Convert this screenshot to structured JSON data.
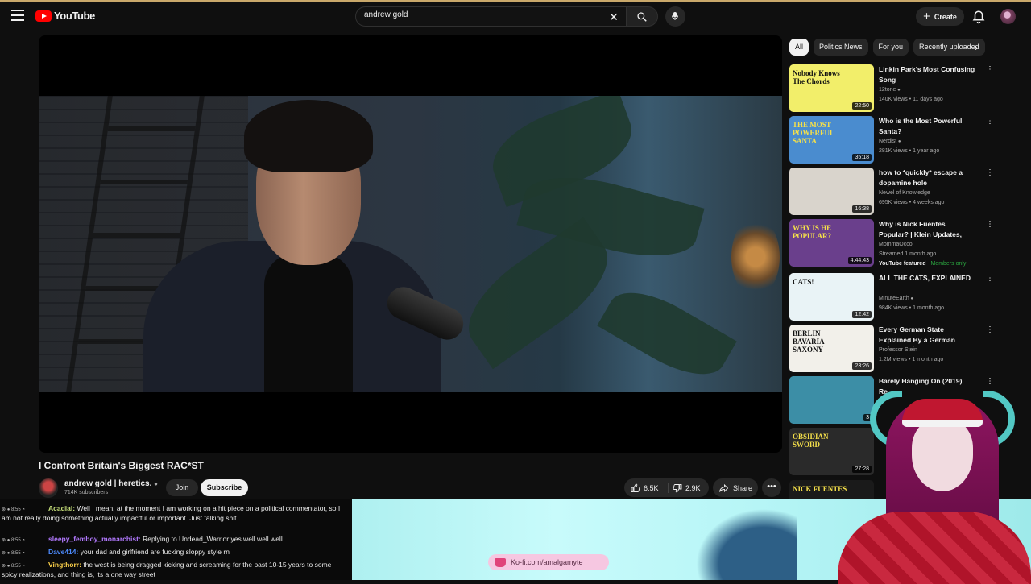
{
  "header": {
    "logo_text": "YouTube",
    "search_value": "andrew gold",
    "create_label": "Create",
    "icons": [
      "menu-icon",
      "youtube-logo",
      "clear-icon",
      "search-icon",
      "mic-icon",
      "plus-icon",
      "bell-icon",
      "avatar"
    ]
  },
  "video": {
    "title": "I Confront Britain's Biggest RAC*ST",
    "channel_name": "andrew gold | heretics.",
    "subscribers": "714K subscribers",
    "join_label": "Join",
    "subscribe_label": "Subscribe",
    "likes": "6.5K",
    "dislikes": "2.9K",
    "share_label": "Share",
    "more_label": "•••"
  },
  "chips": [
    "All",
    "Politics News",
    "For you",
    "Recently uploaded"
  ],
  "recommendations": [
    {
      "title": "Linkin Park's Most Confusing Song",
      "channel": "12tone",
      "verified": true,
      "meta": "140K views • 11 days ago",
      "duration": "22:50",
      "thumb_text": "Nobody Knows The Chords",
      "thumb_color": "#f2ee6a"
    },
    {
      "title": "Who is the Most Powerful Santa?",
      "channel": "Nerdist",
      "verified": true,
      "meta": "281K views • 1 year ago",
      "duration": "35:18",
      "thumb_text": "THE MOST POWERFUL SANTA",
      "thumb_color": "#4a8ccf"
    },
    {
      "title": "how to *quickly* escape a dopamine hole",
      "channel": "Newel of Knowledge",
      "verified": false,
      "meta": "695K views • 4 weeks ago",
      "duration": "16:38",
      "thumb_text": "",
      "thumb_color": "#d9d4cc"
    },
    {
      "title": "Why is Nick Fuentes Popular? | Klein Updates, DSP Asmon ...",
      "channel": "MommaOcco",
      "verified": false,
      "meta": "Streamed 1 month ago",
      "duration": "4:44:43",
      "thumb_text": "WHY IS HE POPULAR?",
      "thumb_color": "#6a3f8c",
      "badge_featured": "YouTube featured",
      "badge_members": "Members only"
    },
    {
      "title": "ALL THE CATS, EXPLAINED",
      "channel": "MinuteEarth",
      "verified": true,
      "meta": "984K views • 1 month ago",
      "duration": "12:42",
      "thumb_text": "CATS!",
      "thumb_color": "#e9f3f6"
    },
    {
      "title": "Every German State Explained By a German",
      "channel": "Professor Stein",
      "verified": false,
      "meta": "1.2M views • 1 month ago",
      "duration": "23:26",
      "thumb_text": "BERLIN BAVARIA SAXONY",
      "thumb_color": "#f2f0ea"
    },
    {
      "title": "Barely Hanging On (2019) Re...",
      "channel": "",
      "verified": false,
      "meta": "",
      "duration": "3",
      "thumb_text": "",
      "thumb_color": "#3c8ea6"
    },
    {
      "title": "",
      "channel": "",
      "verified": false,
      "meta": "",
      "duration": "27:28",
      "thumb_text": "OBSIDIAN SWORD",
      "thumb_color": "#2a2a2a"
    },
    {
      "title": "",
      "channel": "",
      "verified": false,
      "meta": "",
      "duration": "",
      "thumb_text": "NICK FUENTES",
      "thumb_color": "#1a1a1a"
    }
  ],
  "chat": [
    {
      "name": "Acadial:",
      "name_color": "#c7e07a",
      "text": "Well I mean, at the moment I am working on a hit piece on a political commentator, so I am not really doing something actually impactful or important. Just talking shit"
    },
    {
      "name": "sleepy_femboy_monarchist:",
      "name_color": "#b279ff",
      "text": "Replying to Undead_Warrior:yes well well well"
    },
    {
      "name": "Dave414:",
      "name_color": "#4d8cff",
      "text": "your dad and girlfriend are fucking sloppy style rn"
    },
    {
      "name": "Vingthorr:",
      "name_color": "#ffd34a",
      "text": "the west is being dragged kicking and screaming for the past 10-15 years to some spicy realizations, and thing is, its a one way street"
    }
  ],
  "kofi_text": "Ko-fi.com/amalgamyte"
}
